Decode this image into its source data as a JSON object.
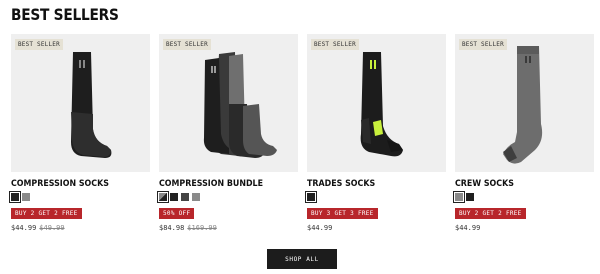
{
  "section": {
    "title": "BEST SELLERS"
  },
  "products": [
    {
      "badge": "BEST SELLER",
      "name": "COMPRESSION SOCKS",
      "swatches": [
        "#1f1f1f",
        "#8a8a8a"
      ],
      "promo": "BUY 2 GET 2 FREE",
      "price": "$44.99",
      "compare_price": "$49.99"
    },
    {
      "badge": "BEST SELLER",
      "name": "COMPRESSION BUNDLE",
      "swatches": [
        "#5a5a5a",
        "#222222",
        "#444444",
        "#8a8a8a"
      ],
      "promo": "50% OFF",
      "price": "$84.98",
      "compare_price": "$169.99"
    },
    {
      "badge": "BEST SELLER",
      "name": "TRADES SOCKS",
      "swatches": [
        "#1f1f1f"
      ],
      "promo": "BUY 3 GET 3 FREE",
      "price": "$44.99",
      "compare_price": ""
    },
    {
      "badge": "BEST SELLER",
      "name": "CREW SOCKS",
      "swatches": [
        "#8a8a8a",
        "#1f1f1f"
      ],
      "promo": "BUY 2 GET 2 FREE",
      "price": "$44.99",
      "compare_price": ""
    }
  ],
  "shop_all": {
    "label": "SHOP ALL"
  },
  "colors": {
    "promo_bg": "#b8262b",
    "badge_bg": "#e5e1d4",
    "image_bg": "#efefef",
    "accent_lime": "#c8f03c"
  }
}
